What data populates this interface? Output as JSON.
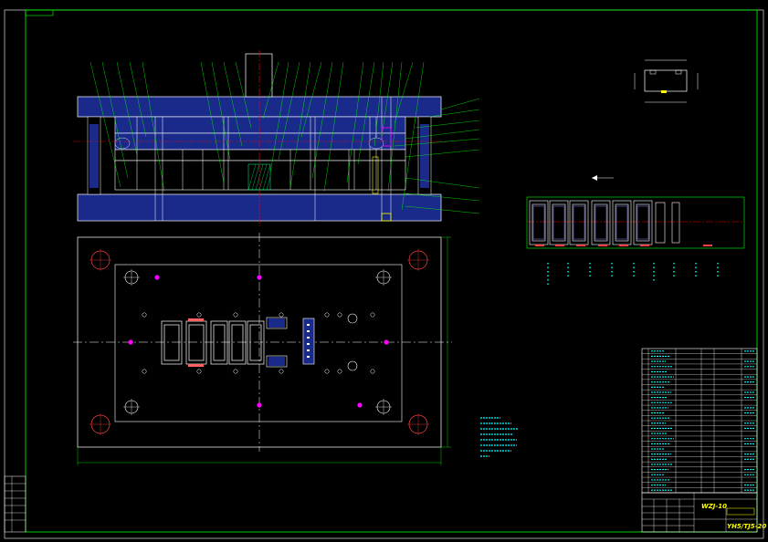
{
  "sheet": {
    "background": "#000000",
    "border_color": "#00ff00",
    "corner_tag": "",
    "scale_label": "",
    "direction_label": ""
  },
  "title_block": {
    "drawing_number": "WZJ-10",
    "part_code": "YH5/TJ5-20",
    "part_name": ""
  },
  "colors": {
    "plate_fill": "#1a2a8a",
    "plate_line": "#ffffff",
    "leader": "#00ff00",
    "centerline": "#ff0000",
    "accent_magenta": "#ff00ff",
    "accent_yellow": "#ffff00",
    "accent_cyan": "#00ffff",
    "hatch_green": "#00ff80"
  },
  "notes": {
    "lines": [
      "",
      "",
      "",
      "",
      "",
      ""
    ]
  }
}
